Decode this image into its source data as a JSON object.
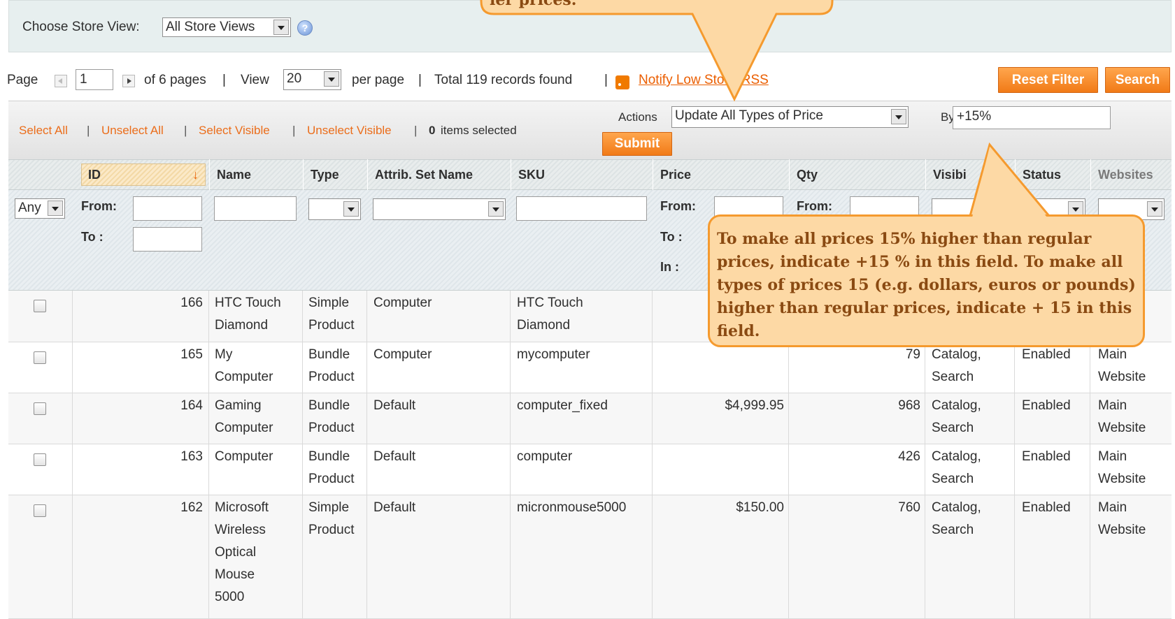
{
  "store_view": {
    "label": "Choose Store View:",
    "selected": "All Store Views"
  },
  "pager": {
    "page_label": "Page",
    "page_value": "1",
    "of_pages": "of 6 pages",
    "sep1": "|",
    "view_label": "View",
    "view_value": "20",
    "per_page": "per page",
    "sep2": "|",
    "total": "Total 119 records found",
    "sep3": "|",
    "rss_link": "Notify Low Stock RSS",
    "reset_filter": "Reset Filter",
    "search": "Search"
  },
  "massaction": {
    "select_all": "Select All",
    "unselect_all": "Unselect All",
    "select_visible": "Select Visible",
    "unselect_visible": "Unselect Visible",
    "sep": "|",
    "count": "0",
    "items_selected": "items selected",
    "actions_label": "Actions",
    "actions_value": "Update All Types of Price",
    "by_label": "By",
    "by_value": "+15%",
    "submit": "Submit"
  },
  "columns": [
    "ID",
    "Name",
    "Type",
    "Attrib. Set Name",
    "SKU",
    "Price",
    "Qty",
    "Visibi",
    "Status",
    "Websites"
  ],
  "filters": {
    "any": "Any",
    "from": "From:",
    "to": "To :",
    "in": "In :"
  },
  "rows": [
    {
      "id": "166",
      "name": [
        "HTC Touch",
        "Diamond"
      ],
      "type": [
        "Simple",
        "Product"
      ],
      "attr": "Computer",
      "sku": [
        "HTC Touch",
        "Diamond"
      ],
      "price": "",
      "qty": "",
      "vis": [],
      "status": "",
      "web": [
        "",
        "ite"
      ]
    },
    {
      "id": "165",
      "name": [
        "My",
        "Computer"
      ],
      "type": [
        "Bundle",
        "Product"
      ],
      "attr": "Computer",
      "sku": [
        "mycomputer"
      ],
      "price": "",
      "qty": "79",
      "vis": [
        "Catalog,",
        "Search"
      ],
      "status": "Enabled",
      "web": [
        "Main",
        "Website"
      ]
    },
    {
      "id": "164",
      "name": [
        "Gaming",
        "Computer"
      ],
      "type": [
        "Bundle",
        "Product"
      ],
      "attr": "Default",
      "sku": [
        "computer_fixed"
      ],
      "price": "$4,999.95",
      "qty": "968",
      "vis": [
        "Catalog,",
        "Search"
      ],
      "status": "Enabled",
      "web": [
        "Main",
        "Website"
      ]
    },
    {
      "id": "163",
      "name": [
        "Computer"
      ],
      "type": [
        "Bundle",
        "Product"
      ],
      "attr": "Default",
      "sku": [
        "computer"
      ],
      "price": "",
      "qty": "426",
      "vis": [
        "Catalog,",
        "Search"
      ],
      "status": "Enabled",
      "web": [
        "Main",
        "Website"
      ]
    },
    {
      "id": "162",
      "name": [
        "Microsoft",
        "Wireless",
        "Optical",
        "Mouse",
        "5000"
      ],
      "type": [
        "Simple",
        "Product"
      ],
      "attr": "Default",
      "sku": [
        "micronmouse5000"
      ],
      "price": "$150.00",
      "qty": "760",
      "vis": [
        "Catalog,",
        "Search"
      ],
      "status": "Enabled",
      "web": [
        "Main",
        "Website"
      ]
    }
  ],
  "callouts": {
    "top": "ier prices.",
    "bottom": "To make all prices 15% higher than regular prices, indicate +15 % in this field. To make all types of prices 15 (e.g. dollars, euros or pounds) higher than regular prices, indicate + 15 in this field."
  },
  "colors": {
    "accent": "#eb5e00",
    "button": "#f17a17",
    "callout_fill": "#fdd9a5",
    "callout_border": "#f59a2e"
  }
}
